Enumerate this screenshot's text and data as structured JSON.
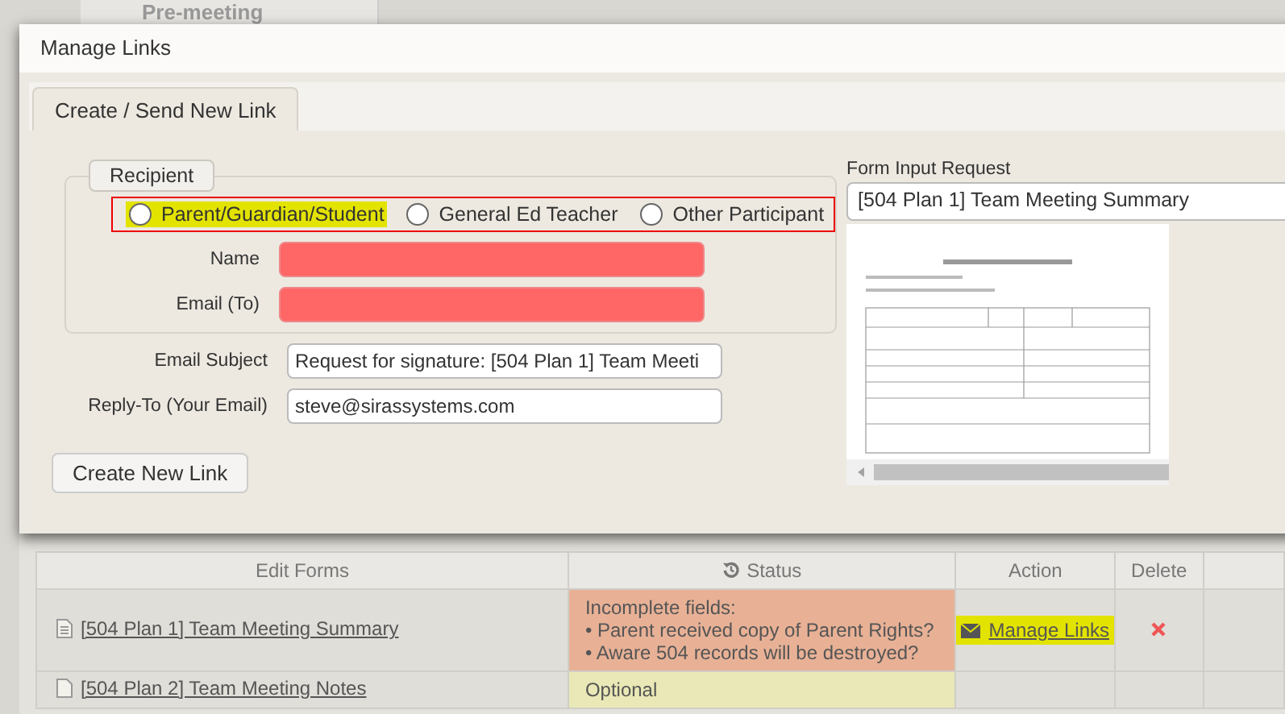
{
  "background_tab": {
    "label": "Pre-meeting"
  },
  "dialog": {
    "title": "Manage Links",
    "tabs": [
      {
        "label": "Create / Send New Link",
        "selected": true
      }
    ],
    "recipient": {
      "legend": "Recipient",
      "outlined": true,
      "options": [
        {
          "label": "Parent/Guardian/Student",
          "selected": false,
          "highlighted": true
        },
        {
          "label": "General Ed Teacher",
          "selected": false,
          "highlighted": false
        },
        {
          "label": "Other Participant",
          "selected": false,
          "highlighted": false
        }
      ],
      "fields": [
        {
          "label": "Name",
          "invalid": true
        },
        {
          "label": "Email (To)",
          "invalid": true
        }
      ]
    },
    "email_subject": {
      "label": "Email Subject",
      "value": "Request for signature: [504 Plan 1] Team Meeti"
    },
    "reply_to": {
      "label": "Reply-To (Your Email)",
      "value": "steve@sirassystems.com"
    },
    "create_button": "Create New Link",
    "form_input": {
      "label": "Form Input Request",
      "value": "[504 Plan 1] Team Meeting Summary"
    }
  },
  "table": {
    "columns": [
      {
        "label": "Edit Forms",
        "icon": false
      },
      {
        "label": "Status",
        "icon": true
      },
      {
        "label": "Action",
        "icon": false
      },
      {
        "label": "Delete",
        "icon": false
      }
    ],
    "rows": [
      {
        "form": "[504 Plan 1] Team Meeting Summary",
        "kind": "text",
        "status": {
          "kind": "incomplete",
          "title": "Incomplete fields:",
          "items": [
            "• Parent received copy of Parent Rights?",
            "• Aware 504 records will be destroyed?"
          ]
        },
        "action": {
          "label": "Manage Links",
          "highlighted": true
        },
        "deletable": true
      },
      {
        "form": "[504 Plan 2] Team Meeting Notes",
        "kind": "blank",
        "status": {
          "kind": "optional",
          "title": "Optional"
        },
        "deletable": false
      }
    ]
  }
}
